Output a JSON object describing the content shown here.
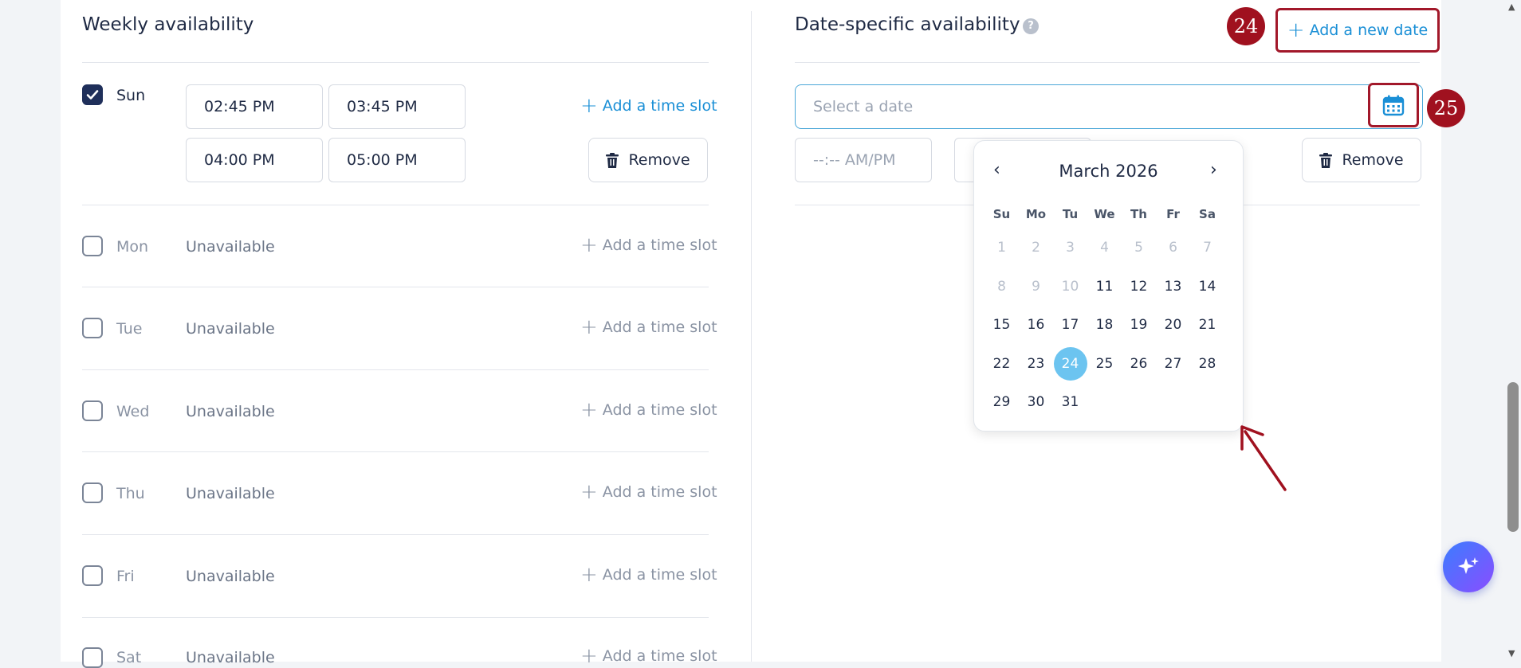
{
  "weekly": {
    "title": "Weekly availability",
    "days": [
      {
        "label": "Sun",
        "checked": true,
        "slots": [
          [
            "02:45 PM",
            "03:45 PM"
          ],
          [
            "04:00 PM",
            "05:00 PM"
          ]
        ]
      },
      {
        "label": "Mon",
        "checked": false,
        "status": "Unavailable"
      },
      {
        "label": "Tue",
        "checked": false,
        "status": "Unavailable"
      },
      {
        "label": "Wed",
        "checked": false,
        "status": "Unavailable"
      },
      {
        "label": "Thu",
        "checked": false,
        "status": "Unavailable"
      },
      {
        "label": "Fri",
        "checked": false,
        "status": "Unavailable"
      },
      {
        "label": "Sat",
        "checked": false,
        "status": "Unavailable"
      }
    ],
    "add_slot_label": "Add a time slot",
    "remove_label": "Remove"
  },
  "date_specific": {
    "title": "Date-specific availability",
    "help": "?",
    "add_date_label": "Add a new date",
    "date_placeholder": "Select a date",
    "time_placeholder": "--:-- AM/PM",
    "remove_label": "Remove"
  },
  "annotations": {
    "badge_1": "24",
    "badge_2": "25",
    "accent": "#a0111f"
  },
  "calendar": {
    "month": "March 2026",
    "weekdays": [
      "Su",
      "Mo",
      "Tu",
      "We",
      "Th",
      "Fr",
      "Sa"
    ],
    "weeks": [
      [
        "1",
        "2",
        "3",
        "4",
        "5",
        "6",
        "7"
      ],
      [
        "8",
        "9",
        "10",
        "11",
        "12",
        "13",
        "14"
      ],
      [
        "15",
        "16",
        "17",
        "18",
        "19",
        "20",
        "21"
      ],
      [
        "22",
        "23",
        "24",
        "25",
        "26",
        "27",
        "28"
      ],
      [
        "29",
        "30",
        "31",
        "",
        "",
        "",
        ""
      ]
    ],
    "disabled": [
      "1",
      "2",
      "3",
      "4",
      "5",
      "6",
      "7",
      "8",
      "9",
      "10"
    ],
    "selected": "24",
    "selected_color": "#6cc4f0"
  },
  "colors": {
    "link": "#1a8fd6",
    "primary": "#1f2f5a"
  }
}
